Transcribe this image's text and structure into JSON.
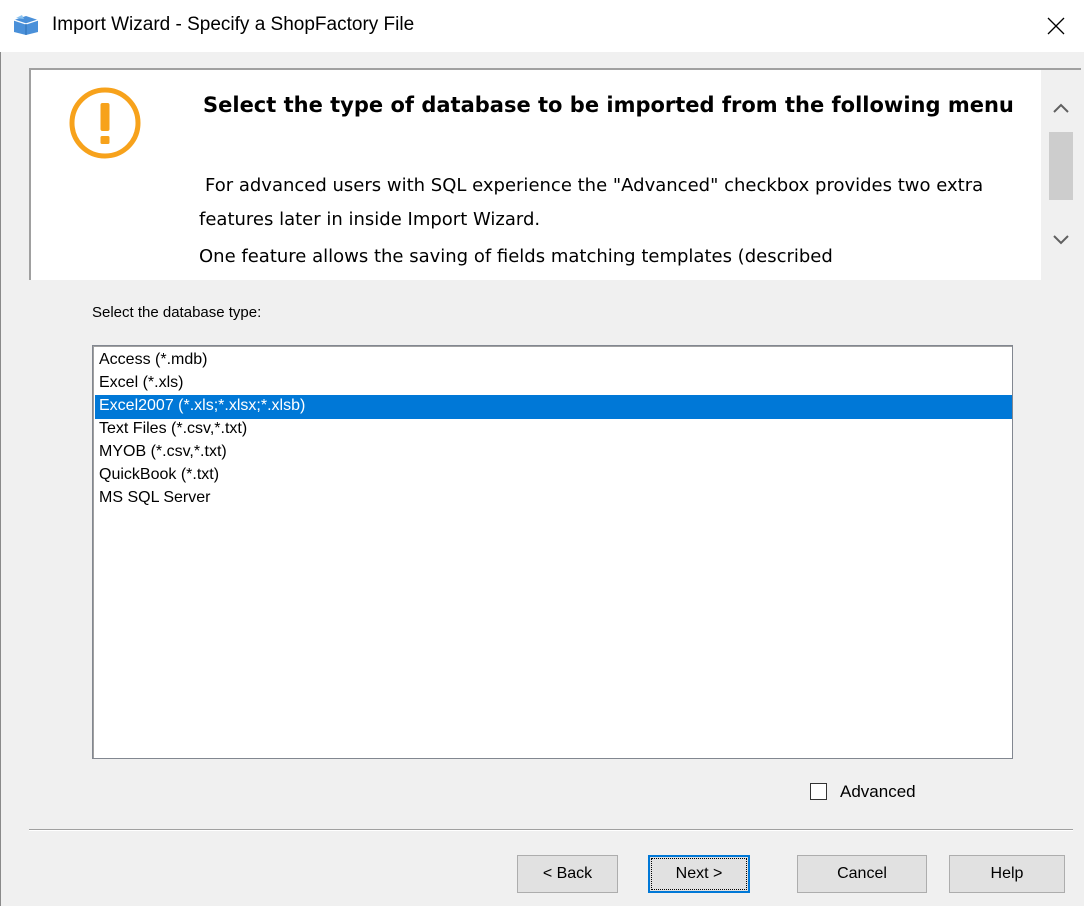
{
  "window": {
    "title": "Import Wizard - Specify a ShopFactory File",
    "app_icon": "shopfactory-icon",
    "close_icon": "close-icon"
  },
  "info": {
    "icon": "warning-icon",
    "heading": "Select the type of database to be imported from the following menu",
    "paragraph1": "For advanced users with SQL experience the \"Advanced\" checkbox provides two extra features later in inside Import Wizard.",
    "paragraph2": "One feature allows the saving of fields matching templates (described",
    "scroll_up_icon": "chevron-up-icon",
    "scroll_down_icon": "chevron-down-icon"
  },
  "select_label": "Select the database type:",
  "database_types": [
    {
      "label": "Access (*.mdb)",
      "selected": false
    },
    {
      "label": "Excel (*.xls)",
      "selected": false
    },
    {
      "label": "Excel2007 (*.xls;*.xlsx;*.xlsb)",
      "selected": true
    },
    {
      "label": "Text Files (*.csv,*.txt)",
      "selected": false
    },
    {
      "label": "MYOB (*.csv,*.txt)",
      "selected": false
    },
    {
      "label": "QuickBook (*.txt)",
      "selected": false
    },
    {
      "label": "MS SQL Server",
      "selected": false
    }
  ],
  "advanced": {
    "label": "Advanced",
    "checked": false
  },
  "buttons": {
    "back": "< Back",
    "next": "Next >",
    "cancel": "Cancel",
    "help": "Help"
  },
  "colors": {
    "selection": "#0078d7",
    "warning": "#f7a21b",
    "background": "#f0f0f0"
  }
}
